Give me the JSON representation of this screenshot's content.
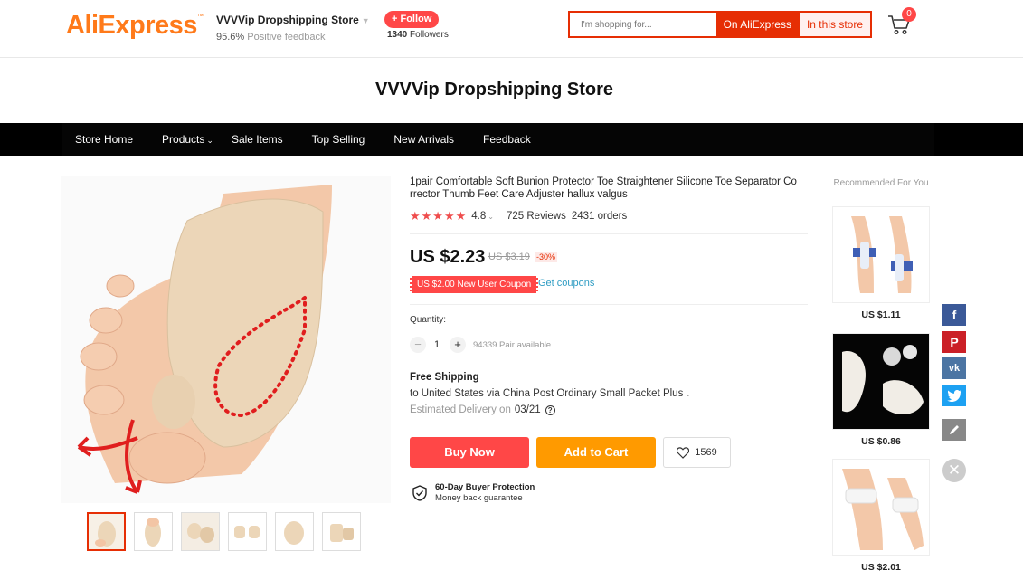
{
  "header": {
    "logo": "AliExpress",
    "logo_tm": "™",
    "store_name": "VVVVip Dropshipping Store",
    "feedback_percent": "95.6%",
    "feedback_label": "Positive feedback",
    "follow_label": "+ Follow",
    "followers_count": "1340",
    "followers_label": "Followers",
    "search_placeholder": "I'm shopping for...",
    "search_on_ali": "On AliExpress",
    "search_in_store": "In this store",
    "cart_count": "0"
  },
  "store_banner": {
    "title": "VVVVip Dropshipping Store"
  },
  "nav": {
    "items": [
      "Store Home",
      "Products",
      "Sale Items",
      "Top Selling",
      "New Arrivals",
      "Feedback"
    ]
  },
  "product": {
    "title": "1pair Comfortable Soft Bunion Protector Toe Straightener Silicone Toe Separator Co rrector Thumb Feet Care Adjuster hallux valgus",
    "rating": "4.8",
    "stars": "★★★★★",
    "reviews": "725 Reviews",
    "orders": "2431 orders",
    "price": "US $2.23",
    "original_price": "US $3.19",
    "discount": "-30%",
    "coupon": "US $2.00 New User Coupon",
    "get_coupons": "Get coupons",
    "quantity_label": "Quantity:",
    "quantity_value": "1",
    "available": "94339 Pair available",
    "shipping_title": "Free Shipping",
    "shipping_dest": "to United States via China Post Ordinary Small Packet Plus",
    "delivery_label": "Estimated Delivery on",
    "delivery_date": "03/21",
    "buy_now": "Buy Now",
    "add_to_cart": "Add to Cart",
    "wishlist_count": "1569",
    "protection_title": "60-Day Buyer Protection",
    "protection_sub": "Money back guarantee",
    "thumbnail_count": 6
  },
  "recommended": {
    "title": "Recommended For You",
    "items": [
      {
        "price": "US $1.11"
      },
      {
        "price": "US $0.86"
      },
      {
        "price": "US $2.01"
      }
    ]
  },
  "share": {
    "icons": [
      "facebook-icon",
      "pinterest-icon",
      "vk-icon",
      "twitter-icon",
      "edit-icon",
      "close-icon"
    ],
    "colors": {
      "facebook": "#3b5998",
      "pinterest": "#cb2027",
      "vk": "#4c75a3",
      "twitter": "#1da1f2",
      "edit": "#888888"
    }
  },
  "colors": {
    "accent": "#ff4747",
    "brand_orange": "#ff7a1a",
    "cart_orange": "#ff9a00",
    "link": "#2e9cc3"
  }
}
